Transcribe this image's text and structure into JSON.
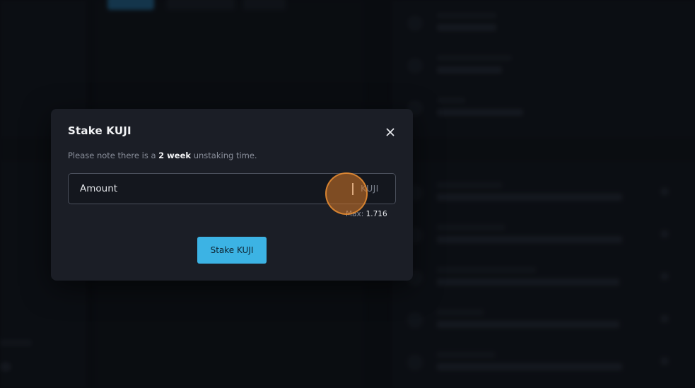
{
  "modal": {
    "title": "Stake KUJI",
    "note_prefix": "Please note there is a ",
    "note_bold": "2 week",
    "note_suffix": " unstaking time.",
    "amount_placeholder": "Amount",
    "amount_value": "",
    "unit": "KUJI",
    "max_label": "Max: ",
    "max_value": "1.716",
    "stake_button_label": "Stake KUJI"
  },
  "icons": {
    "close": "close-icon"
  },
  "colors": {
    "modal_bg": "#1b1e26",
    "accent": "#3cb3e4",
    "backdrop": "#0c0e13",
    "click_indicator": "#d67828"
  }
}
